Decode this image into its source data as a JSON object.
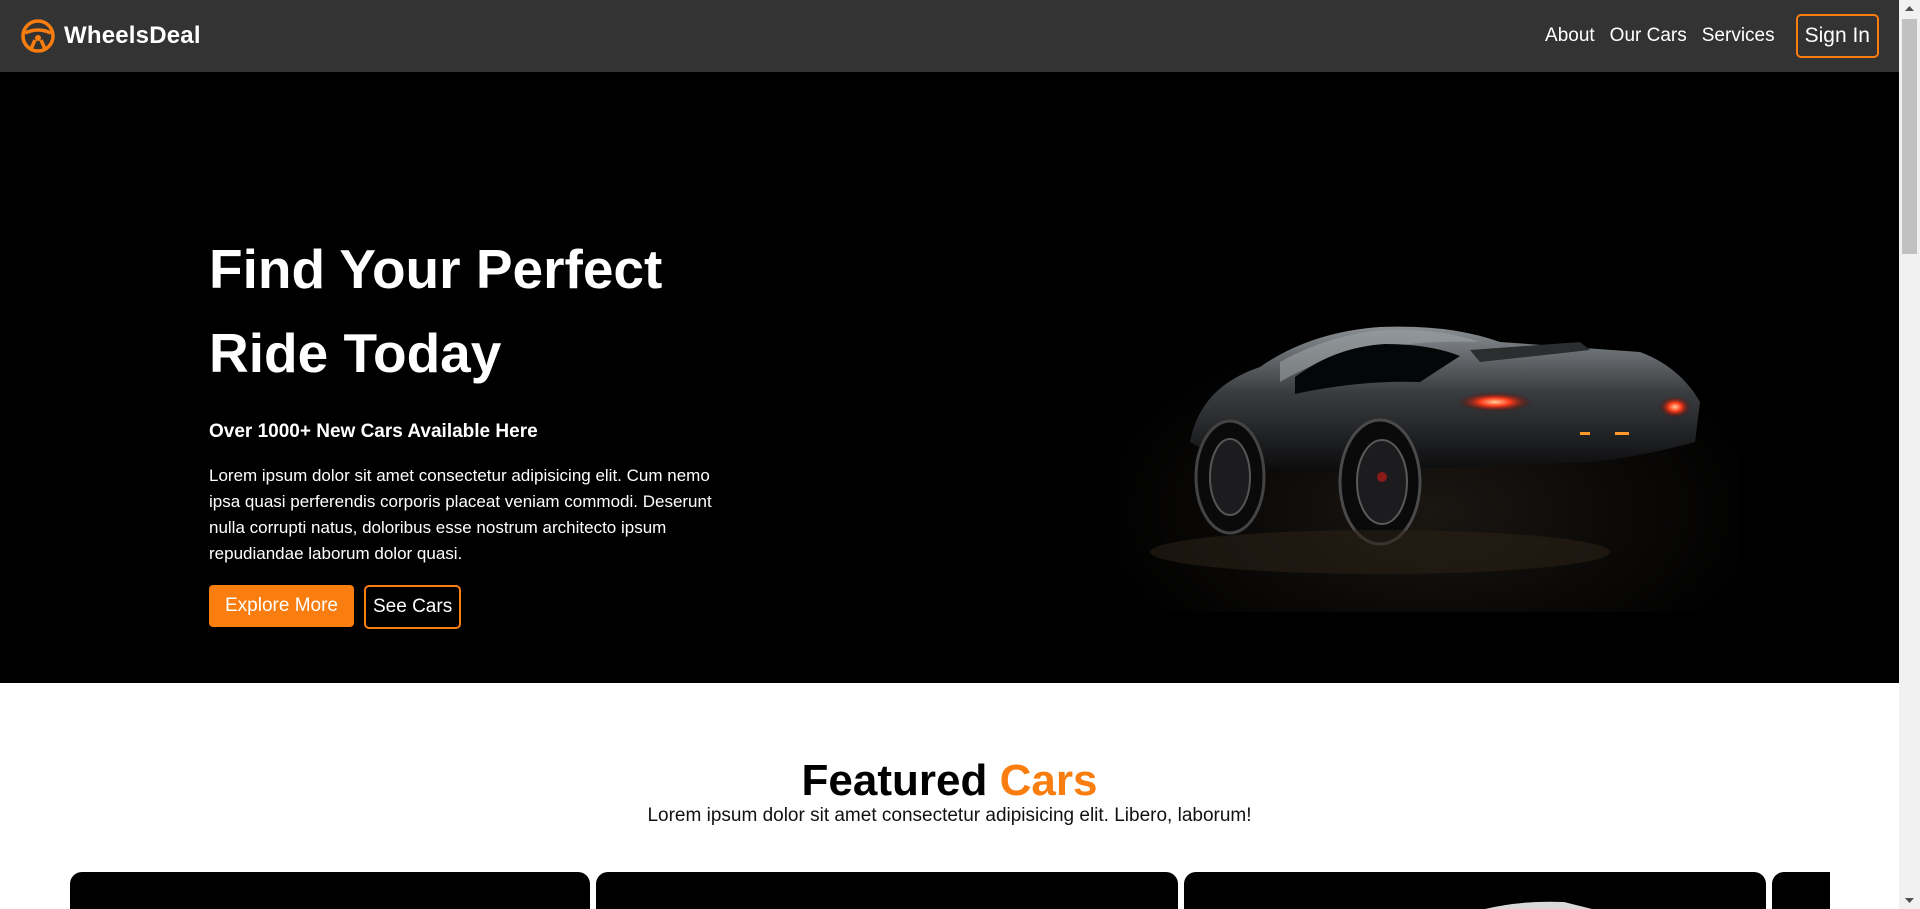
{
  "brand": {
    "name": "WheelsDeal",
    "icon": "steering-wheel-icon",
    "accent": "#f97d0f"
  },
  "nav": {
    "links": [
      "About",
      "Our Cars",
      "Services"
    ],
    "signin_label": "Sign In",
    "background": "#333333"
  },
  "hero": {
    "title_line1": "Find Your Perfect",
    "title_line2": "Ride Today",
    "subtitle": "Over 1000+ New Cars Available Here",
    "text": "Lorem ipsum dolor sit amet consectetur adipisicing elit. Cum nemo ipsa quasi perferendis corporis placeat veniam commodi. Deserunt nulla corrupti natus, doloribus esse nostrum architecto ipsum repudiandae laborum dolor quasi.",
    "explore_label": "Explore More",
    "see_cars_label": "See Cars",
    "image": "dark-sports-car-image"
  },
  "featured": {
    "title_main": "Featured",
    "title_accent": "Cars",
    "subtitle": "Lorem ipsum dolor sit amet consectetur adipisicing elit. Libero, laborum!"
  }
}
